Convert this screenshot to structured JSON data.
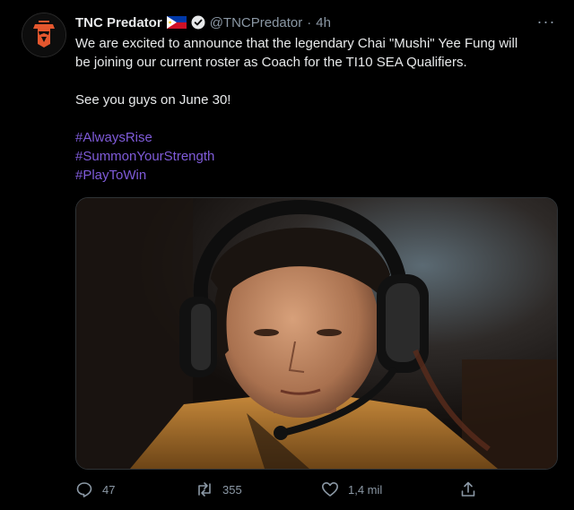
{
  "tweet": {
    "display_name": "TNC Predator",
    "handle": "@TNCPredator",
    "separator": "·",
    "time": "4h",
    "more_label": "···",
    "text_line1": "We are excited to announce that the legendary Chai \"Mushi\" Yee Fung will",
    "text_line2": "be joining our current roster as Coach for the TI10 SEA Qualifiers.",
    "text_line3": "See you guys on June 30!",
    "hashtags": [
      "#AlwaysRise",
      "#SummonYourStrength",
      "#PlayToWin"
    ],
    "flag_icon": "philippines-flag-icon",
    "verified_icon": "verified-badge-icon"
  },
  "actions": {
    "reply_count": "47",
    "retweet_count": "355",
    "like_count": "1,4 mil"
  },
  "colors": {
    "background": "#000000",
    "text": "#e7e9ea",
    "muted": "#8b98a5",
    "hashtag": "#7f5bd9",
    "verified": "#e7e9ea"
  }
}
